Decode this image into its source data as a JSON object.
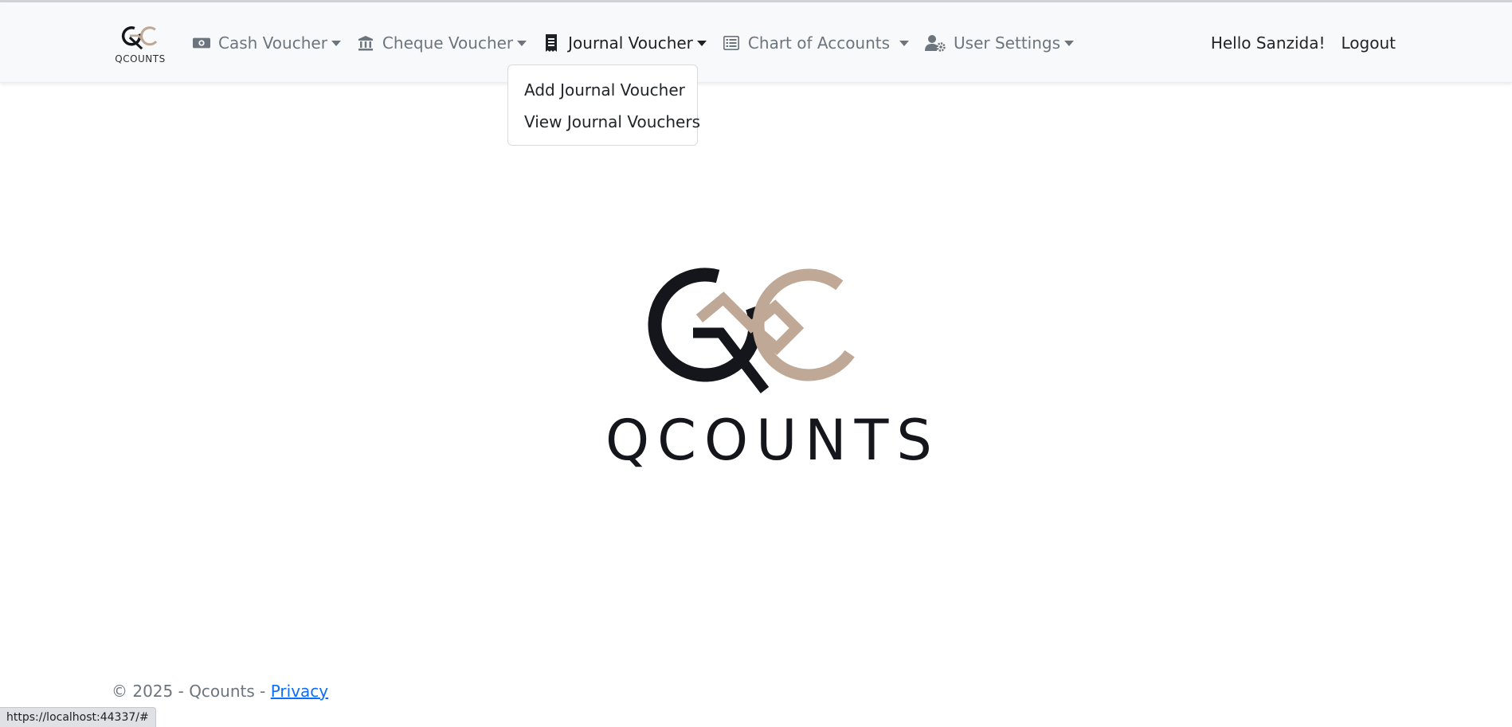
{
  "brand": {
    "name": "QCOUNTS",
    "logo_icon": "qc-logo-icon"
  },
  "nav": {
    "items": [
      {
        "label": "Cash Voucher",
        "icon": "money-bill-icon"
      },
      {
        "label": "Cheque Voucher",
        "icon": "bank-icon"
      },
      {
        "label": "Journal Voucher",
        "icon": "receipt-icon",
        "active": true
      },
      {
        "label": "Chart of Accounts",
        "icon": "list-alt-icon"
      },
      {
        "label": "User Settings",
        "icon": "user-gear-icon"
      }
    ],
    "greeting": "Hello Sanzida!",
    "logout": "Logout"
  },
  "dropdown": {
    "items": [
      "Add Journal Voucher",
      "View Journal Vouchers"
    ]
  },
  "hero": {
    "title": "QCOUNTS"
  },
  "footer": {
    "copyright": "© 2025 - Qcounts - ",
    "privacy": "Privacy"
  },
  "statusbar": {
    "url": "https://localhost:44337/#"
  },
  "colors": {
    "logo_dark": "#14161b",
    "logo_tan": "#bfa895",
    "link": "#0d6efd",
    "navbar_bg": "#f8f9fa"
  }
}
